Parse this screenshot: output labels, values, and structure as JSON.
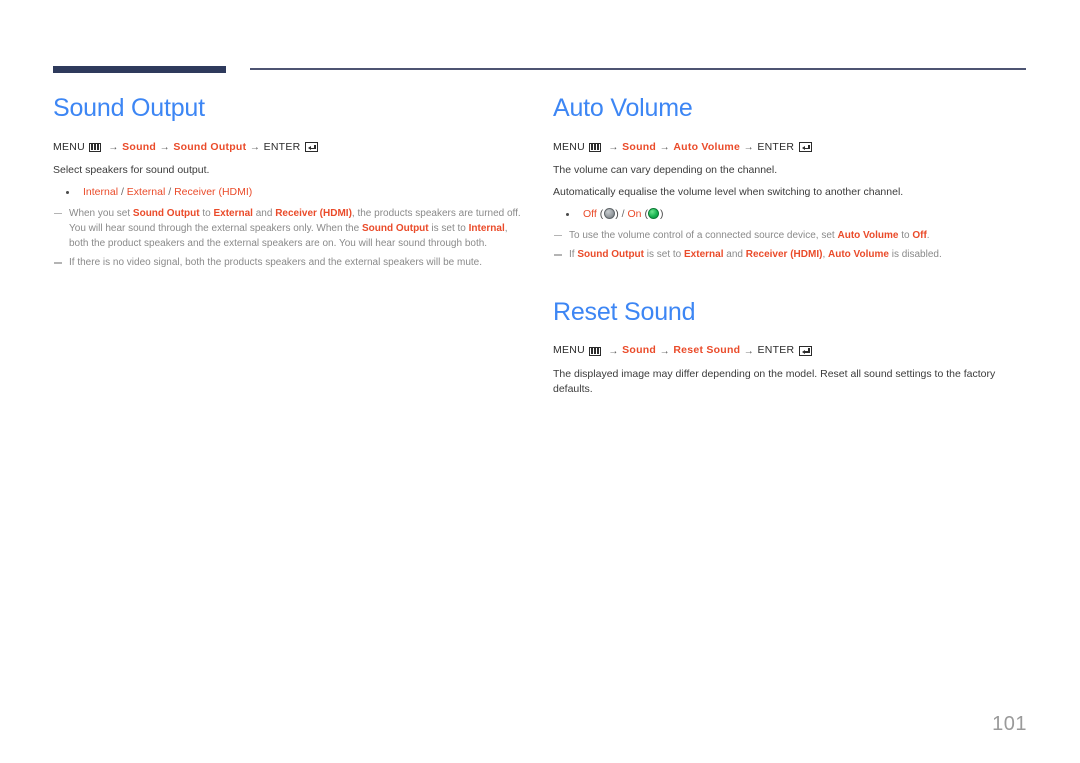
{
  "header": {
    "rule_thick_color": "#2e3a5c",
    "rule_thin_color": "#4d5472"
  },
  "colors": {
    "heading_blue": "#3d86f4",
    "accent_orange": "#ea4b2a",
    "body_gray": "#3b3b3b",
    "note_gray": "#8a8a8a",
    "page_number_gray": "#9a9a9a",
    "toggle_off": "#9aa0a4",
    "toggle_on": "#18b451"
  },
  "left_column": {
    "section": {
      "title": "Sound Output",
      "menu_path": {
        "menu_label": "MENU",
        "menu_icon": "menu-grid-icon",
        "arrow": "→",
        "step1": "Sound",
        "step2": "Sound Output",
        "enter_label": "ENTER",
        "enter_icon": "enter-key-icon"
      },
      "intro": "Select speakers for sound output.",
      "options": [
        {
          "v1": "Internal",
          "sep1": " / ",
          "v2": "External",
          "sep2": " / ",
          "v3": "Receiver (HDMI)"
        }
      ],
      "notes": [
        {
          "paragraphs": [
            {
              "runs": [
                {
                  "t": "When you set ",
                  "style": "plain"
                },
                {
                  "t": "Sound Output",
                  "style": "hl"
                },
                {
                  "t": " to ",
                  "style": "plain"
                },
                {
                  "t": "External",
                  "style": "hl"
                },
                {
                  "t": " and ",
                  "style": "plain"
                },
                {
                  "t": "Receiver (HDMI)",
                  "style": "hl"
                },
                {
                  "t": ", the products speakers are turned off.",
                  "style": "plain"
                }
              ]
            },
            {
              "runs": [
                {
                  "t": "You will hear sound through the external speakers only. When the ",
                  "style": "plain"
                },
                {
                  "t": "Sound Output",
                  "style": "hl"
                },
                {
                  "t": " is set to ",
                  "style": "plain"
                },
                {
                  "t": "Internal",
                  "style": "hl"
                },
                {
                  "t": ", both the product speakers and the external speakers are on. You will hear sound through both.",
                  "style": "plain"
                }
              ]
            }
          ]
        },
        {
          "paragraphs": [
            {
              "runs": [
                {
                  "t": "If there is no video signal, both the products speakers and the external speakers will be mute.",
                  "style": "plain"
                }
              ]
            }
          ]
        }
      ]
    }
  },
  "right_column": {
    "sections": [
      {
        "title": "Auto Volume",
        "menu_path": {
          "menu_label": "MENU",
          "menu_icon": "menu-grid-icon",
          "arrow": "→",
          "step1": "Sound",
          "step2": "Auto Volume",
          "enter_label": "ENTER",
          "enter_icon": "enter-key-icon"
        },
        "body_lines": [
          "The volume can vary depending on the channel.",
          "Automatically equalise the volume level when switching to another channel."
        ],
        "toggle_option": {
          "off_label": "Off",
          "off_icon": "toggle-off-dot-icon",
          "separator": " / ",
          "on_label": "On",
          "on_icon": "toggle-on-dot-icon"
        },
        "notes": [
          {
            "paragraphs": [
              {
                "runs": [
                  {
                    "t": "To use the volume control of a connected source device, set ",
                    "style": "plain"
                  },
                  {
                    "t": "Auto Volume",
                    "style": "hl"
                  },
                  {
                    "t": " to ",
                    "style": "plain"
                  },
                  {
                    "t": "Off",
                    "style": "hl"
                  },
                  {
                    "t": ".",
                    "style": "plain"
                  }
                ]
              }
            ]
          },
          {
            "paragraphs": [
              {
                "runs": [
                  {
                    "t": "If ",
                    "style": "plain"
                  },
                  {
                    "t": "Sound Output",
                    "style": "hl"
                  },
                  {
                    "t": " is set to ",
                    "style": "plain"
                  },
                  {
                    "t": "External",
                    "style": "hl"
                  },
                  {
                    "t": " and ",
                    "style": "plain"
                  },
                  {
                    "t": "Receiver (HDMI)",
                    "style": "hl"
                  },
                  {
                    "t": ", ",
                    "style": "plain"
                  },
                  {
                    "t": "Auto Volume",
                    "style": "hl"
                  },
                  {
                    "t": " is disabled.",
                    "style": "plain"
                  }
                ]
              }
            ]
          }
        ]
      },
      {
        "title": "Reset Sound",
        "menu_path": {
          "menu_label": "MENU",
          "menu_icon": "menu-grid-icon",
          "arrow": "→",
          "step1": "Sound",
          "step2": "Reset Sound",
          "enter_label": "ENTER",
          "enter_icon": "enter-key-icon"
        },
        "body_lines": [
          "The displayed image may differ depending on the model. Reset all sound settings to the factory defaults."
        ],
        "toggle_option": null,
        "notes": []
      }
    ]
  },
  "footer": {
    "page_number": "101"
  }
}
